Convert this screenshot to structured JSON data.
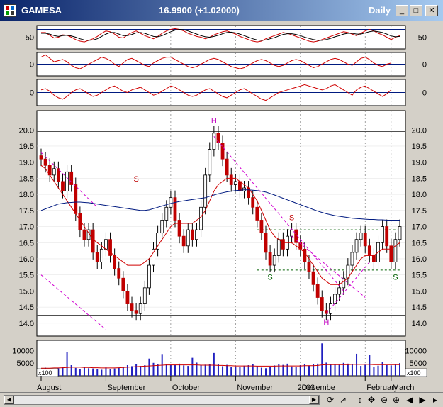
{
  "window": {
    "symbol": "GAMESA",
    "price_text": "16.9900 (+1.02000)",
    "period": "Daily",
    "buttons": {
      "minimize": "_",
      "maximize": "□",
      "close": "✕"
    }
  },
  "colors": {
    "titlebar_start": "#0a246a",
    "candle": "#c00000",
    "ma_short": "#d00000",
    "ma_long": "#001a80",
    "trendline": "#d000d0",
    "indicator": "#d00000",
    "grid": "#7a7a7a"
  },
  "chart_data": [
    {
      "type": "line",
      "panel": "oscillator-1",
      "y_ticks": [
        50
      ],
      "ylim": [
        20,
        80
      ],
      "series": [
        {
          "values": [
            62,
            62,
            55,
            48,
            50,
            56,
            55,
            50,
            44,
            40,
            38,
            42,
            46,
            52,
            60,
            66,
            64,
            58,
            50,
            48,
            56,
            62,
            66,
            60,
            54,
            50,
            46,
            52,
            60,
            66,
            70,
            72,
            70,
            66,
            60,
            56,
            52,
            50,
            46,
            50,
            56,
            60,
            64,
            66,
            62,
            58,
            52,
            48,
            44,
            40,
            38,
            40,
            46,
            50,
            54,
            58,
            62,
            60,
            56,
            52,
            48,
            44,
            40,
            38,
            40,
            44,
            48,
            52,
            56,
            60,
            64,
            62,
            58,
            54,
            60,
            66,
            70,
            66,
            60,
            56,
            50,
            44,
            50,
            54
          ]
        },
        {
          "values": [
            60,
            60,
            58,
            54,
            52,
            54,
            55,
            53,
            50,
            46,
            43,
            42,
            43,
            46,
            52,
            58,
            62,
            62,
            58,
            54,
            54,
            57,
            61,
            62,
            60,
            56,
            52,
            51,
            54,
            59,
            64,
            68,
            70,
            69,
            66,
            62,
            58,
            54,
            51,
            50,
            52,
            55,
            59,
            62,
            63,
            61,
            58,
            54,
            50,
            46,
            43,
            42,
            43,
            46,
            49,
            53,
            57,
            59,
            59,
            57,
            54,
            50,
            47,
            44,
            42,
            42,
            44,
            47,
            51,
            54,
            58,
            60,
            60,
            58,
            58,
            61,
            64,
            66,
            64,
            62,
            58,
            53,
            51,
            52
          ]
        }
      ],
      "hlines": [
        70,
        30
      ]
    },
    {
      "type": "line",
      "panel": "oscillator-2",
      "y_ticks": [
        0
      ],
      "ylim": [
        -1,
        1
      ],
      "series": [
        {
          "values": [
            0.6,
            0.8,
            0.5,
            0.2,
            0.3,
            0.4,
            0.2,
            -0.1,
            -0.3,
            -0.4,
            -0.2,
            0.0,
            0.2,
            0.4,
            0.6,
            0.5,
            0.3,
            0.0,
            -0.2,
            0.1,
            0.4,
            0.5,
            0.3,
            0.1,
            -0.1,
            -0.2,
            0.1,
            0.3,
            0.5,
            0.6,
            0.6,
            0.4,
            0.2,
            0.0,
            -0.2,
            -0.3,
            -0.2,
            0.0,
            0.2,
            0.4,
            0.5,
            0.4,
            0.2,
            0.0,
            -0.2,
            -0.3,
            -0.4,
            -0.3,
            -0.1,
            0.1,
            0.3,
            0.4,
            0.3,
            0.1,
            -0.1,
            -0.2,
            -0.1,
            0.1,
            0.3,
            0.4,
            0.3,
            0.1,
            -0.1,
            -0.3,
            -0.2,
            0.0,
            0.2,
            0.4,
            0.5,
            0.4,
            0.2,
            0.0,
            -0.1,
            0.2,
            0.5,
            0.6,
            0.4,
            0.1,
            -0.1,
            -0.2,
            0.0,
            0.1
          ]
        }
      ],
      "hlines": [
        0
      ]
    },
    {
      "type": "line",
      "panel": "oscillator-3",
      "y_ticks": [
        0
      ],
      "ylim": [
        -1,
        1
      ],
      "series": [
        {
          "values": [
            0.2,
            0.3,
            0.1,
            -0.2,
            -0.4,
            -0.5,
            -0.3,
            0.0,
            0.2,
            0.3,
            0.1,
            -0.1,
            -0.3,
            -0.2,
            0.0,
            0.2,
            0.4,
            0.5,
            0.3,
            0.1,
            0.0,
            0.2,
            0.3,
            0.4,
            0.2,
            0.0,
            -0.2,
            -0.1,
            0.1,
            0.3,
            0.5,
            0.4,
            0.2,
            0.0,
            -0.2,
            -0.3,
            -0.2,
            0.0,
            0.2,
            0.3,
            0.1,
            -0.1,
            -0.3,
            -0.4,
            -0.2,
            0.0,
            0.2,
            0.3,
            0.1,
            -0.1,
            -0.3,
            -0.5,
            -0.6,
            -0.4,
            -0.2,
            0.0,
            0.1,
            0.2,
            0.3,
            0.4,
            0.5,
            0.6,
            0.5,
            0.4,
            0.3,
            0.2,
            0.3,
            0.5,
            0.6,
            0.4,
            0.2,
            0.0,
            -0.2,
            0.2,
            0.4,
            0.5,
            0.3,
            0.1,
            -0.1,
            -0.3,
            -0.1,
            0.2
          ]
        }
      ],
      "hlines": [
        0
      ]
    },
    {
      "type": "candlestick",
      "panel": "price",
      "ylim": [
        13.6,
        20.6
      ],
      "y_ticks": [
        14.0,
        14.5,
        15.0,
        15.5,
        16.0,
        16.5,
        17.0,
        17.5,
        18.0,
        18.5,
        19.0,
        19.5,
        20.0
      ],
      "y_tick_labels": [
        "14.0",
        "14.5",
        "15.0",
        "15.5",
        "16.0",
        "16.5",
        "17.0",
        "17.5",
        "18.0",
        "18.5",
        "19.0",
        "19.5",
        "20.0"
      ],
      "closes": [
        19.1,
        18.9,
        18.6,
        18.8,
        18.4,
        18.1,
        18.7,
        18.3,
        17.4,
        16.9,
        16.6,
        16.9,
        16.2,
        15.9,
        16.3,
        16.6,
        16.1,
        15.7,
        15.4,
        15.0,
        14.6,
        14.4,
        14.3,
        14.6,
        15.1,
        15.8,
        16.3,
        16.8,
        17.2,
        17.6,
        17.9,
        17.2,
        16.7,
        16.4,
        16.9,
        16.6,
        16.9,
        17.6,
        18.6,
        19.4,
        19.9,
        19.6,
        19.1,
        18.6,
        18.3,
        18.4,
        18.1,
        18.2,
        17.9,
        17.6,
        17.2,
        16.8,
        16.2,
        15.8,
        16.1,
        16.6,
        16.3,
        16.7,
        16.9,
        16.5,
        16.3,
        15.9,
        15.6,
        15.2,
        14.8,
        14.4,
        14.3,
        14.6,
        14.9,
        15.1,
        15.4,
        15.8,
        16.2,
        16.6,
        16.8,
        16.4,
        16.1,
        15.9,
        16.5,
        17.0,
        16.4,
        15.9,
        16.6,
        17.0
      ],
      "series": [
        {
          "values": [
            18.9,
            18.8,
            18.6,
            18.4,
            18.2,
            18.0,
            17.8,
            17.6,
            17.4,
            17.2,
            17.0,
            16.8,
            16.6,
            16.5,
            16.4,
            16.3,
            16.2,
            16.1,
            16.0,
            15.9,
            15.8,
            15.8,
            15.8,
            15.8,
            15.9,
            16.0,
            16.2,
            16.4,
            16.6,
            16.8,
            17.0,
            17.1,
            17.1,
            17.1,
            17.1,
            17.1,
            17.2,
            17.3,
            17.5,
            17.8,
            18.1,
            18.3,
            18.4,
            18.5,
            18.5,
            18.5,
            18.4,
            18.3,
            18.2,
            18.0,
            17.8,
            17.5,
            17.2,
            16.9,
            16.7,
            16.6,
            16.5,
            16.5,
            16.5,
            16.4,
            16.3,
            16.2,
            16.0,
            15.8,
            15.6,
            15.4,
            15.3,
            15.2,
            15.2,
            15.2,
            15.3,
            15.4,
            15.6,
            15.8,
            16.0,
            16.1,
            16.1,
            16.1,
            16.2,
            16.3,
            16.3,
            16.3,
            16.4,
            16.5
          ]
        },
        {
          "values": [
            17.5,
            17.55,
            17.6,
            17.65,
            17.7,
            17.72,
            17.74,
            17.75,
            17.76,
            17.76,
            17.75,
            17.74,
            17.72,
            17.7,
            17.68,
            17.66,
            17.64,
            17.62,
            17.6,
            17.58,
            17.56,
            17.54,
            17.52,
            17.5,
            17.5,
            17.52,
            17.56,
            17.6,
            17.64,
            17.68,
            17.72,
            17.75,
            17.78,
            17.8,
            17.82,
            17.84,
            17.86,
            17.88,
            17.9,
            17.94,
            17.98,
            18.02,
            18.05,
            18.08,
            18.1,
            18.12,
            18.13,
            18.14,
            18.14,
            18.13,
            18.12,
            18.1,
            18.07,
            18.03,
            17.98,
            17.93,
            17.88,
            17.83,
            17.78,
            17.73,
            17.68,
            17.63,
            17.58,
            17.53,
            17.48,
            17.44,
            17.4,
            17.37,
            17.34,
            17.32,
            17.3,
            17.28,
            17.26,
            17.25,
            17.24,
            17.23,
            17.22,
            17.22,
            17.21,
            17.21,
            17.2,
            17.2,
            17.2,
            17.2
          ]
        }
      ],
      "hlines": [
        19.95,
        14.25
      ],
      "dotted_lines": [
        16.9,
        15.65
      ],
      "annotations": [
        {
          "text": "S",
          "x": 22,
          "y": 18.4
        },
        {
          "text": "H",
          "x": 40,
          "y": 20.2
        },
        {
          "text": "S",
          "x": 58,
          "y": 17.2
        },
        {
          "text": "S",
          "x": 53,
          "y": 15.35
        },
        {
          "text": "H",
          "x": 66,
          "y": 13.95
        },
        {
          "text": "S",
          "x": 82,
          "y": 15.35
        }
      ]
    },
    {
      "type": "bar",
      "panel": "volume",
      "ylim": [
        0,
        14000
      ],
      "y_ticks": [
        5000,
        10000
      ],
      "y_tick_labels": [
        "5000",
        "10000"
      ],
      "unit_label": "x100",
      "values": [
        2800,
        3200,
        2600,
        2400,
        3000,
        3400,
        9500,
        4200,
        3100,
        2800,
        3600,
        3000,
        2900,
        2600,
        2400,
        3300,
        2700,
        2900,
        3100,
        3600,
        4200,
        3800,
        4600,
        3900,
        4200,
        6800,
        5100,
        4700,
        8600,
        4600,
        4200,
        4300,
        4800,
        4100,
        3900,
        7100,
        5200,
        4200,
        4400,
        4600,
        9000,
        4700,
        3800,
        4300,
        3600,
        3700,
        3500,
        4000,
        4200,
        4600,
        3800,
        3200,
        3000,
        3600,
        4100,
        4600,
        4300,
        4800,
        3700,
        3600,
        4200,
        4700,
        4100,
        4500,
        4800,
        12800,
        5200,
        4600,
        4400,
        4300,
        5100,
        4800,
        4600,
        8700,
        3900,
        4300,
        8200,
        3500,
        4000,
        5600,
        4200,
        4100,
        4700,
        5000
      ],
      "series": [
        {
          "values": [
            3000,
            3000,
            3000,
            3100,
            3100,
            3200,
            3300,
            3400,
            3400,
            3400,
            3300,
            3300,
            3200,
            3200,
            3100,
            3100,
            3100,
            3100,
            3200,
            3300,
            3400,
            3500,
            3600,
            3700,
            3800,
            3900,
            4000,
            4100,
            4200,
            4300,
            4300,
            4300,
            4300,
            4300,
            4300,
            4300,
            4300,
            4200,
            4200,
            4200,
            4200,
            4100,
            4100,
            4000,
            4000,
            3900,
            3900,
            3900,
            3900,
            3900,
            3800,
            3800,
            3800,
            3800,
            3800,
            3900,
            3900,
            3900,
            3900,
            3900,
            3900,
            4000,
            4000,
            4000,
            4100,
            4300,
            4400,
            4400,
            4400,
            4400,
            4400,
            4400,
            4500,
            4500,
            4500,
            4500,
            4500,
            4400,
            4400,
            4400,
            4400,
            4400,
            4400,
            4400
          ]
        }
      ]
    },
    {
      "type": "axis",
      "panel": "time-axis",
      "x_ticks": [
        0,
        15,
        30,
        45,
        60,
        75,
        81
      ],
      "x_tick_labels": [
        "August",
        "September",
        "October",
        "November",
        "Decembe",
        "February",
        "March"
      ],
      "year_label": {
        "x": 59,
        "text": "2003"
      }
    }
  ]
}
